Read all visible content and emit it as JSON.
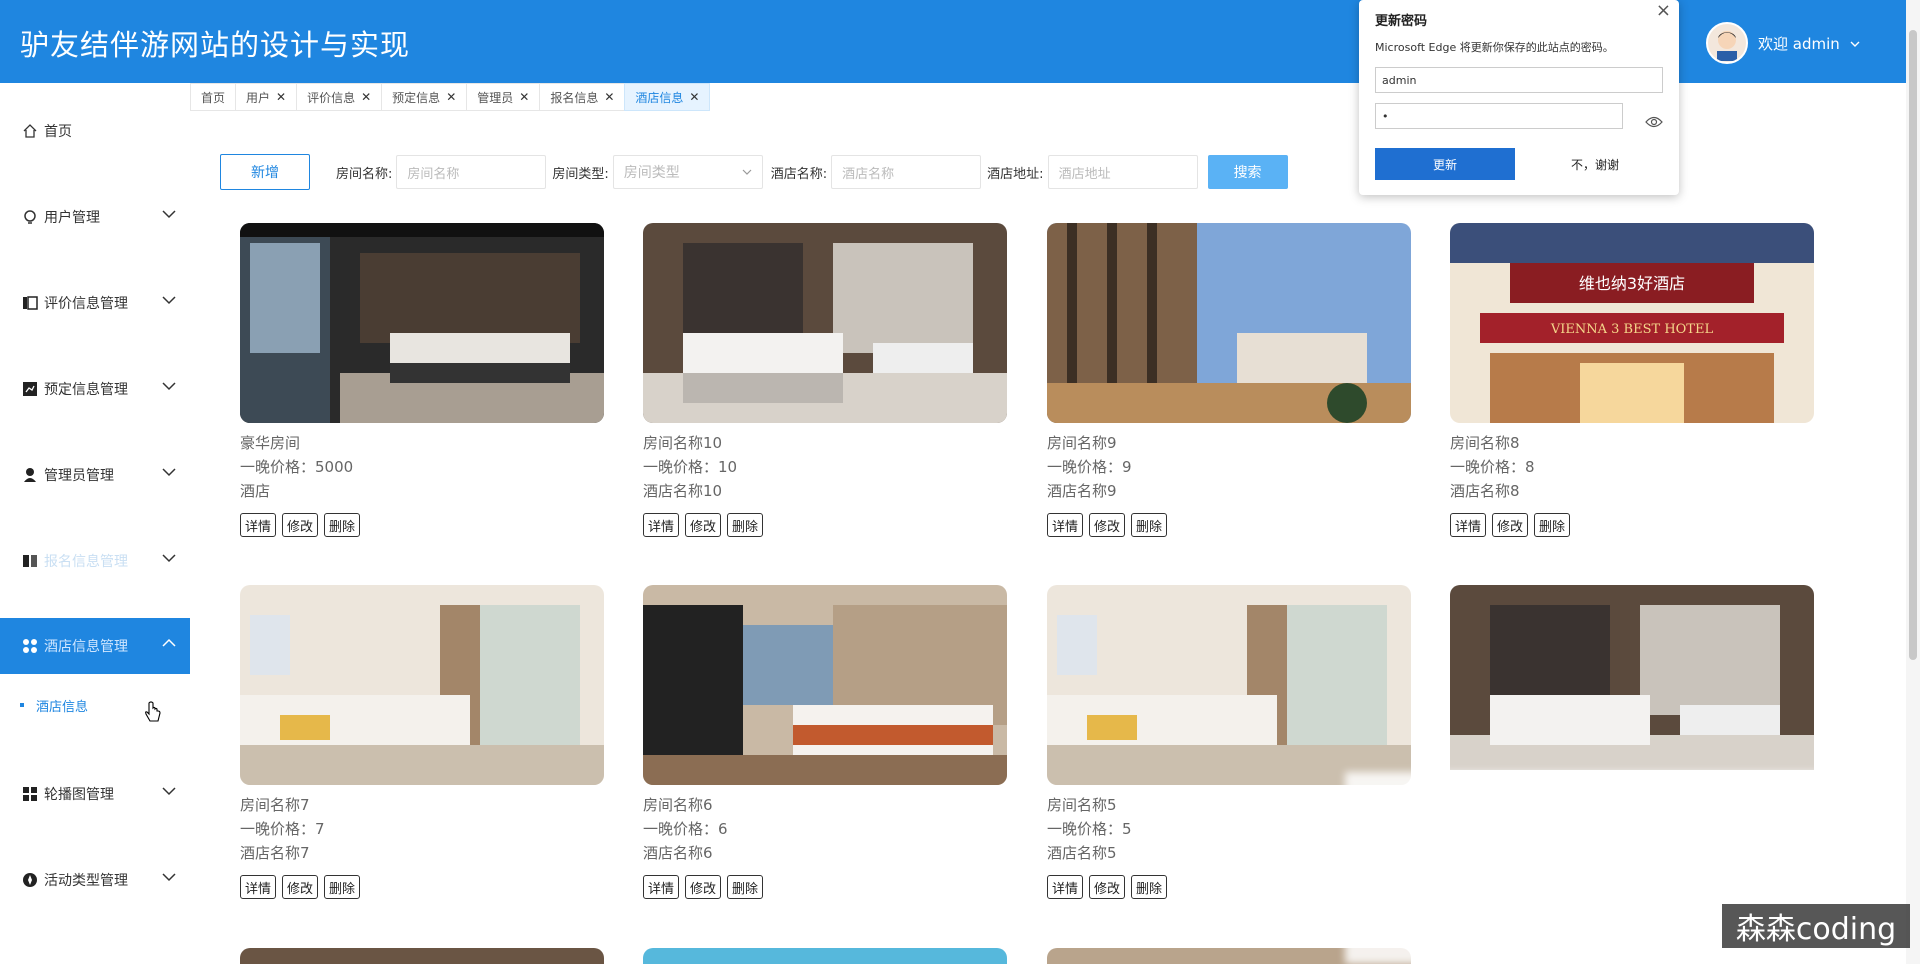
{
  "header": {
    "title": "驴友结伴游网站的设计与实现",
    "welcome": "欢迎 admin"
  },
  "sidebar": {
    "items": [
      {
        "label": "首页"
      },
      {
        "label": "用户管理"
      },
      {
        "label": "评价信息管理"
      },
      {
        "label": "预定信息管理"
      },
      {
        "label": "管理员管理"
      },
      {
        "label": "报名信息管理"
      },
      {
        "label": "酒店信息管理"
      },
      {
        "label": "轮播图管理"
      },
      {
        "label": "活动类型管理"
      }
    ],
    "sub_item": "酒店信息"
  },
  "tabs": [
    {
      "label": "首页"
    },
    {
      "label": "用户"
    },
    {
      "label": "评价信息"
    },
    {
      "label": "预定信息"
    },
    {
      "label": "管理员"
    },
    {
      "label": "报名信息"
    },
    {
      "label": "酒店信息"
    }
  ],
  "search": {
    "new_label": "新增",
    "room_name_label": "房间名称:",
    "room_name_placeholder": "房间名称",
    "room_type_label": "房间类型:",
    "room_type_placeholder": "房间类型",
    "hotel_name_label": "酒店名称:",
    "hotel_name_placeholder": "酒店名称",
    "hotel_addr_label": "酒店地址:",
    "hotel_addr_placeholder": "酒店地址",
    "search_label": "搜索"
  },
  "cards": [
    {
      "name": "豪华房间",
      "price": "一晚价格：5000",
      "hotel": "酒店"
    },
    {
      "name": "房间名称10",
      "price": "一晚价格：10",
      "hotel": "酒店名称10"
    },
    {
      "name": "房间名称9",
      "price": "一晚价格：9",
      "hotel": "酒店名称9"
    },
    {
      "name": "房间名称8",
      "price": "一晚价格：8",
      "hotel": "酒店名称8"
    },
    {
      "name": "房间名称7",
      "price": "一晚价格：7",
      "hotel": "酒店名称7"
    },
    {
      "name": "房间名称6",
      "price": "一晚价格：6",
      "hotel": "酒店名称6"
    },
    {
      "name": "房间名称5",
      "price": "一晚价格：5",
      "hotel": "酒店名称5"
    }
  ],
  "ops": {
    "detail": "详情",
    "edit": "修改",
    "delete": "删除"
  },
  "popup": {
    "title": "更新密码",
    "desc": "Microsoft Edge 将更新你保存的此站点的密码。",
    "username": "admin",
    "password": "•",
    "update": "更新",
    "no": "不，谢谢"
  },
  "hotel_sign": {
    "line1": "维也纳3好酒店",
    "line2": "VIENNA 3 BEST HOTEL"
  },
  "watermark": "森森coding",
  "colors": {
    "primary": "#1f86e0",
    "search": "#5ab2f5"
  }
}
